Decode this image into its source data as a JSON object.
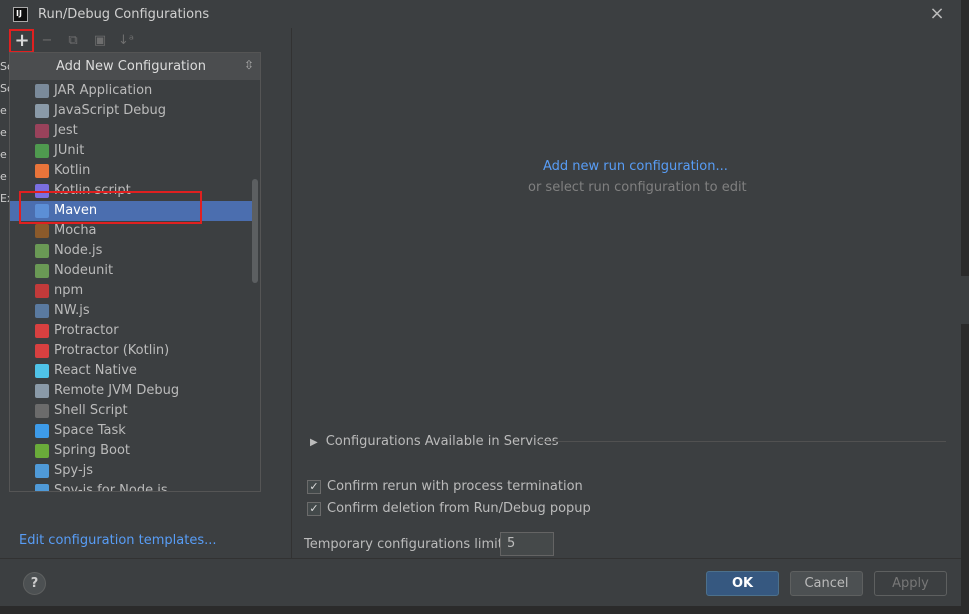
{
  "window": {
    "title": "Run/Debug Configurations",
    "app_icon_text": "IJ"
  },
  "toolbar": {
    "add_label": "+",
    "remove_label": "−",
    "copy_label": "⧉",
    "folder_label": "▣",
    "sort_label": "↓ᵃ"
  },
  "left_strip": {
    "chars": [
      "So",
      "So",
      "e",
      "e",
      "e",
      "e",
      "Ex"
    ]
  },
  "popup": {
    "title": "Add New Configuration",
    "items": [
      {
        "label": "JAR Application",
        "icon": "jar-icon",
        "color": "#7a8a9a"
      },
      {
        "label": "JavaScript Debug",
        "icon": "javascript-debug-icon",
        "color": "#8a9aa8"
      },
      {
        "label": "Jest",
        "icon": "jest-icon",
        "color": "#99425b"
      },
      {
        "label": "JUnit",
        "icon": "junit-icon",
        "color": "#4f9a4f"
      },
      {
        "label": "Kotlin",
        "icon": "kotlin-icon",
        "color": "#e9743a"
      },
      {
        "label": "Kotlin script",
        "icon": "kotlin-script-icon",
        "color": "#7a6fe0"
      },
      {
        "label": "Maven",
        "icon": "maven-icon",
        "color": "#5c8fd6"
      },
      {
        "label": "Mocha",
        "icon": "mocha-icon",
        "color": "#8b5a2b"
      },
      {
        "label": "Node.js",
        "icon": "nodejs-icon",
        "color": "#6a9955"
      },
      {
        "label": "Nodeunit",
        "icon": "nodeunit-icon",
        "color": "#6a9955"
      },
      {
        "label": "npm",
        "icon": "npm-icon",
        "color": "#c23a3a"
      },
      {
        "label": "NW.js",
        "icon": "nwjs-icon",
        "color": "#5a7aa0"
      },
      {
        "label": "Protractor",
        "icon": "protractor-icon",
        "color": "#d84040"
      },
      {
        "label": "Protractor (Kotlin)",
        "icon": "protractor-kotlin-icon",
        "color": "#d84040"
      },
      {
        "label": "React Native",
        "icon": "react-native-icon",
        "color": "#4fc3e8"
      },
      {
        "label": "Remote JVM Debug",
        "icon": "remote-jvm-debug-icon",
        "color": "#8a9aa8"
      },
      {
        "label": "Shell Script",
        "icon": "shell-script-icon",
        "color": "#6b6b6b"
      },
      {
        "label": "Space Task",
        "icon": "space-task-icon",
        "color": "#3d9be9"
      },
      {
        "label": "Spring Boot",
        "icon": "spring-boot-icon",
        "color": "#6aab3a"
      },
      {
        "label": "Spy-js",
        "icon": "spy-js-icon",
        "color": "#4f9ad8"
      },
      {
        "label": "Spy-js for Node.js",
        "icon": "spy-js-node-icon",
        "color": "#4f9ad8"
      }
    ],
    "selected_index": 6
  },
  "right": {
    "link": "Add new run configuration...",
    "sub": "or select run configuration to edit",
    "services": "Configurations Available in Services"
  },
  "options": {
    "confirm_rerun": "Confirm rerun with process termination",
    "confirm_deletion": "Confirm deletion from Run/Debug popup",
    "temp_limit_label": "Temporary configurations limit:",
    "temp_limit_value": "5"
  },
  "footer": {
    "edit_templates": "Edit configuration templates...",
    "help": "?",
    "ok": "OK",
    "cancel": "Cancel",
    "apply": "Apply"
  }
}
